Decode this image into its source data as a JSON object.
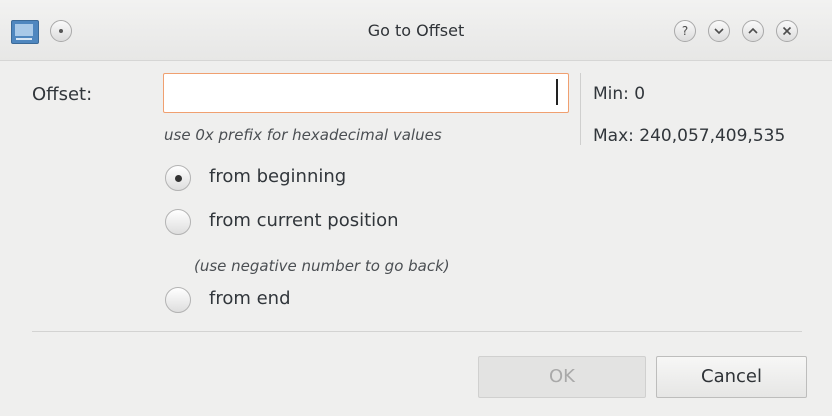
{
  "window": {
    "title": "Go to Offset",
    "icons": {
      "app": "app-window-icon",
      "menu": "window-menu-icon",
      "help": "help-icon",
      "minimize": "minimize-icon",
      "maximize": "maximize-icon",
      "close": "close-icon"
    }
  },
  "offset": {
    "label": "Offset:",
    "value": "",
    "hint": "use 0x prefix for hexadecimal values"
  },
  "range": {
    "min_label": "Min: 0",
    "max_label": "Max: 240,057,409,535"
  },
  "mode": {
    "options": [
      {
        "label": "from beginning",
        "checked": true
      },
      {
        "label": "from current position",
        "checked": false
      },
      {
        "label": "from end",
        "checked": false
      }
    ],
    "current_hint": "(use negative number to go back)"
  },
  "buttons": {
    "ok_label": "OK",
    "ok_enabled": false,
    "cancel_label": "Cancel"
  },
  "colors": {
    "input_focus_border": "#f0a070",
    "app_icon": "#4f87bf"
  }
}
